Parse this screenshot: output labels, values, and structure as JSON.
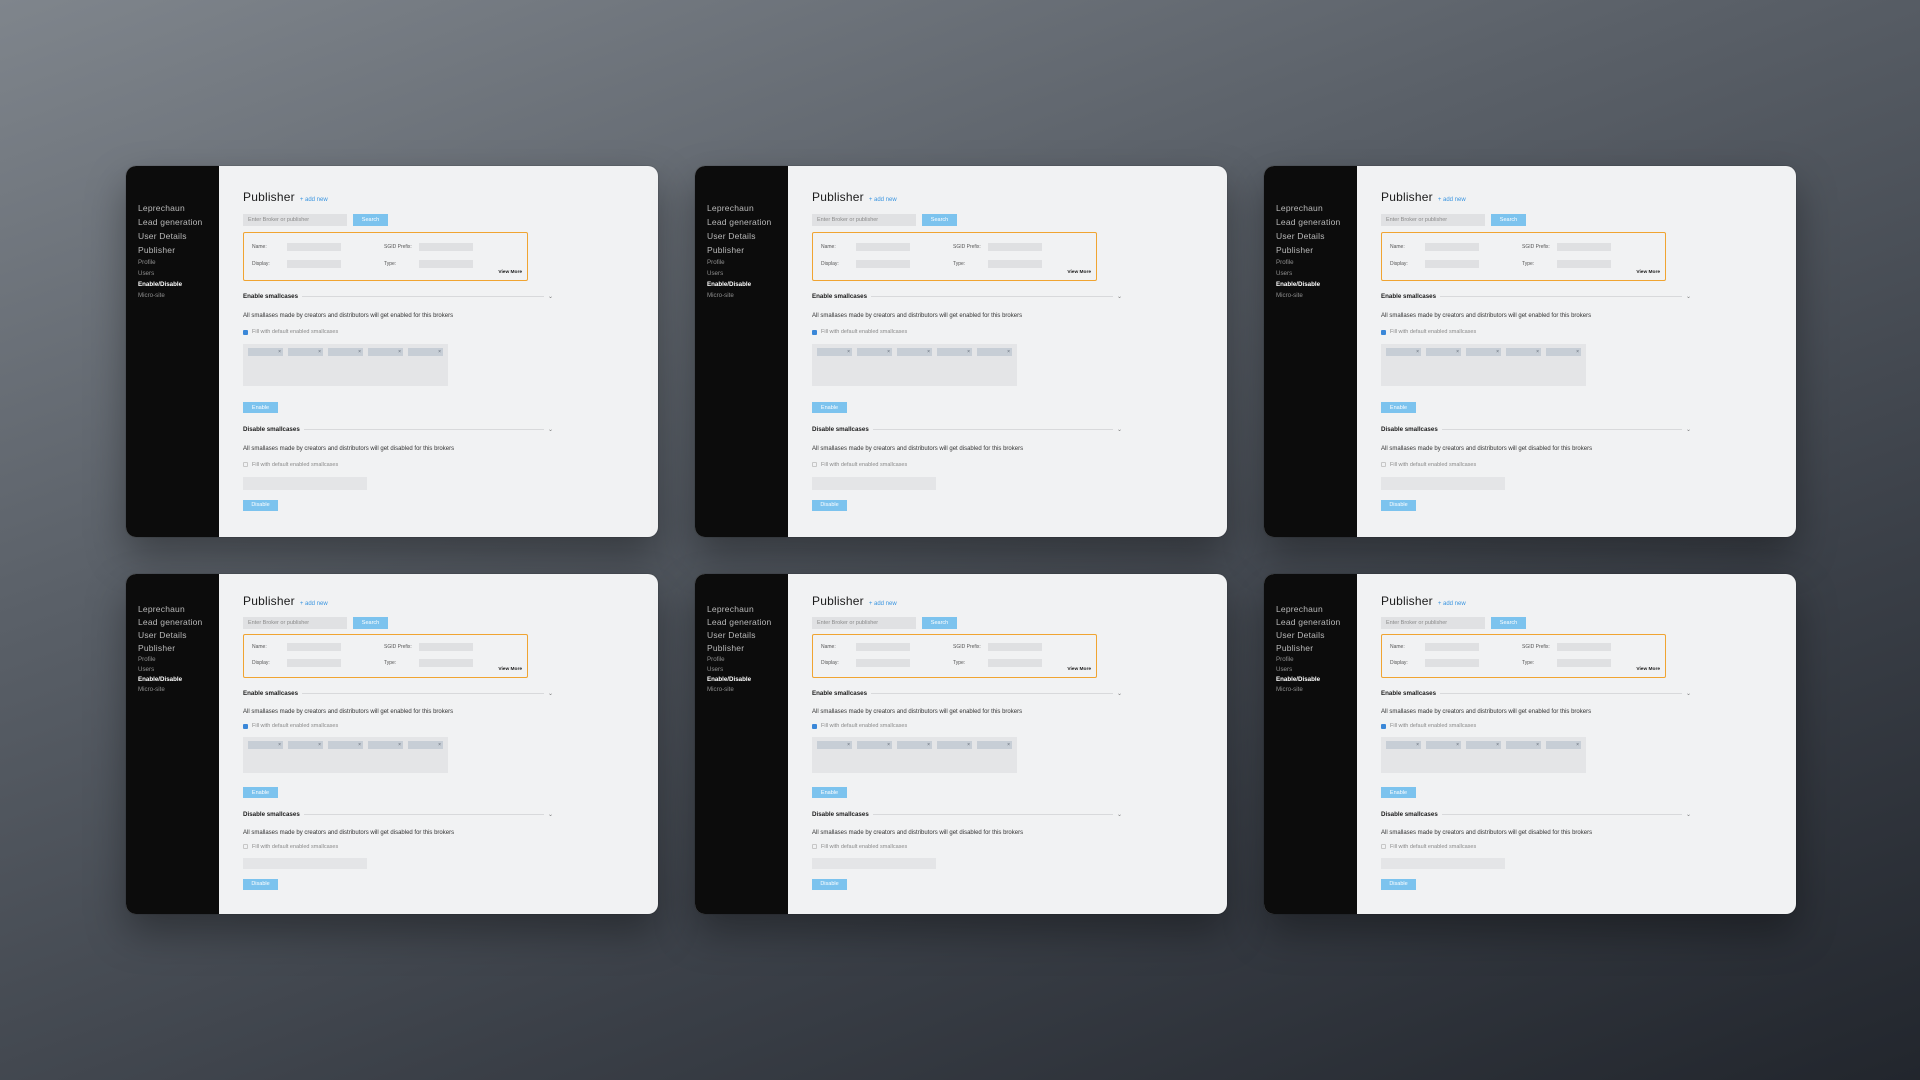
{
  "sidebar": {
    "main_items": [
      "Leprechaun",
      "Lead generation",
      "User Details",
      "Publisher"
    ],
    "sub_items": [
      "Profile",
      "Users",
      "Enable/Disable",
      "Micro-site"
    ],
    "active_sub": "Enable/Disable"
  },
  "page": {
    "title": "Publisher",
    "add_new": "+ add new"
  },
  "search": {
    "placeholder": "Enter Broker or publisher",
    "button": "Search"
  },
  "details": {
    "name_label": "Name:",
    "display_label": "Display:",
    "sgid_label": "SGID Prefix:",
    "type_label": "Type:",
    "view_more": "View More"
  },
  "enable_section": {
    "title": "Enable smallcases",
    "description": "All smallases made by creators and distributors will get enabled for this brokers",
    "checkbox_label": "Fill with default enabled smallcases",
    "checkbox_checked": true,
    "chip_count": 5,
    "button": "Enable"
  },
  "disable_section": {
    "title": "Disable smallcases",
    "description": "All smallases made by creators and distributors will get disabled for this brokers",
    "checkbox_label": "Fill with default enabled smallcases",
    "checkbox_checked": false,
    "button": "Disable"
  },
  "colors": {
    "accent_blue": "#7cc3ee",
    "highlight_orange": "#f0a431",
    "sidebar_bg": "#0c0c0c"
  },
  "cards": [
    "card-1",
    "card-2",
    "card-3",
    "card-4",
    "card-5",
    "card-6"
  ]
}
